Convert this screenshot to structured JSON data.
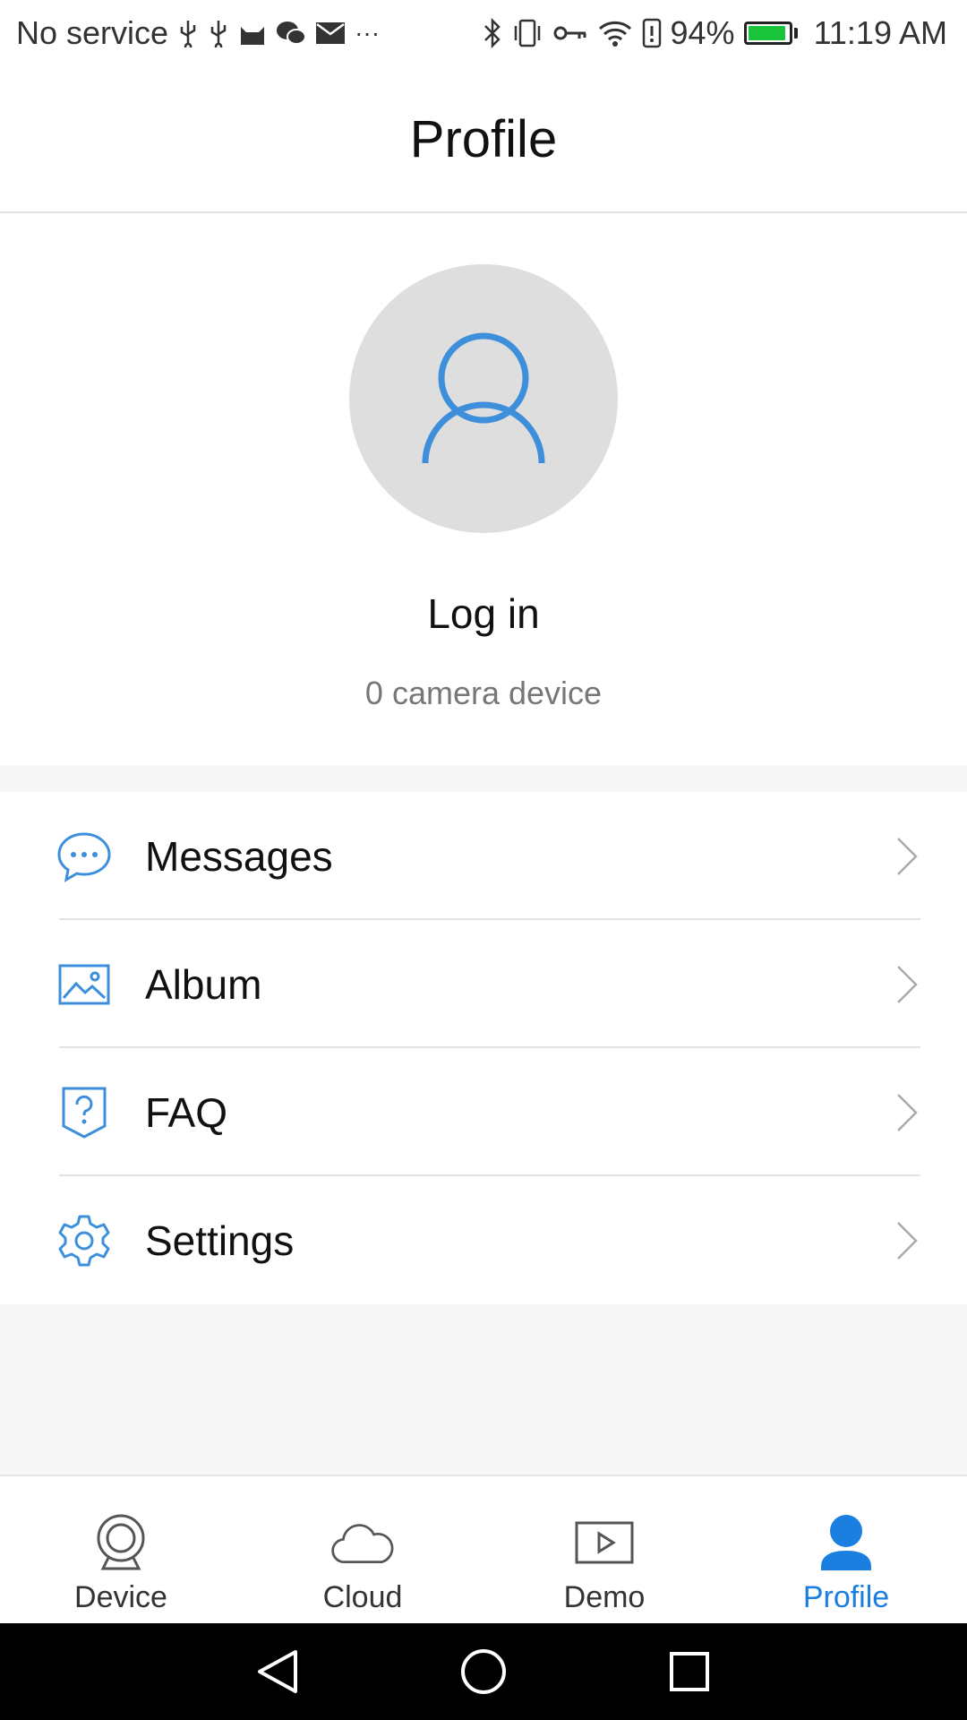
{
  "status_bar": {
    "carrier": "No service",
    "battery_percent": "94%",
    "battery_level": 0.94,
    "time": "11:19 AM",
    "overflow": "···"
  },
  "header": {
    "title": "Profile"
  },
  "profile": {
    "login_label": "Log in",
    "device_count": "0 camera device"
  },
  "menu": {
    "items": [
      {
        "label": "Messages",
        "icon": "chat-bubble-icon"
      },
      {
        "label": "Album",
        "icon": "image-icon"
      },
      {
        "label": "FAQ",
        "icon": "question-badge-icon"
      },
      {
        "label": "Settings",
        "icon": "gear-icon"
      }
    ]
  },
  "tabs": [
    {
      "label": "Device",
      "icon": "camera-icon",
      "active": false
    },
    {
      "label": "Cloud",
      "icon": "cloud-icon",
      "active": false
    },
    {
      "label": "Demo",
      "icon": "play-icon",
      "active": false
    },
    {
      "label": "Profile",
      "icon": "person-icon",
      "active": true
    }
  ],
  "colors": {
    "accent": "#1a7fe0",
    "icon_blue": "#3d8fdc",
    "avatar_bg": "#dedede",
    "battery": "#19c43b"
  }
}
